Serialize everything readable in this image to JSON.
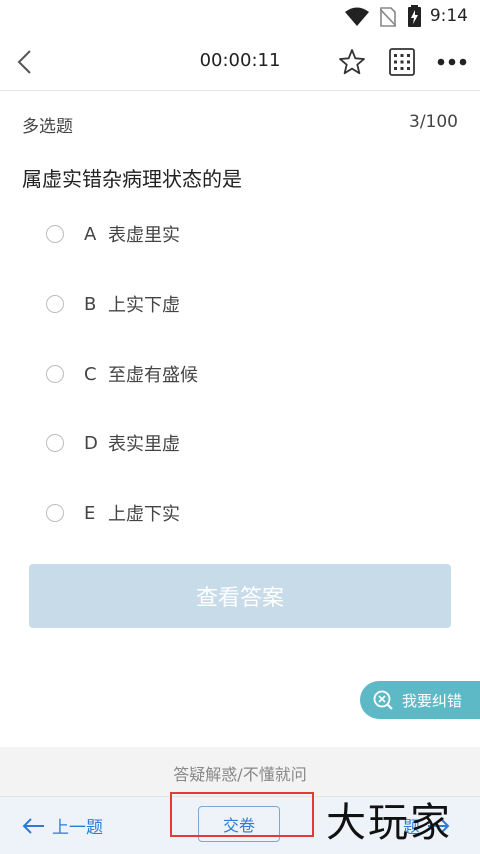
{
  "status_bar": {
    "time": "9:14"
  },
  "header": {
    "timer": "00:00:11"
  },
  "question_meta": {
    "type": "多选题",
    "progress": "3/100"
  },
  "question": {
    "text": "属虚实错杂病理状态的是"
  },
  "options": [
    {
      "letter": "A",
      "text": "表虚里实"
    },
    {
      "letter": "B",
      "text": "上实下虚"
    },
    {
      "letter": "C",
      "text": "至虚有盛候"
    },
    {
      "letter": "D",
      "text": "表实里虚"
    },
    {
      "letter": "E",
      "text": "上虚下实"
    }
  ],
  "view_answer_label": "查看答案",
  "correction_label": "我要纠错",
  "qa_label": "答疑解惑/不懂就问",
  "bottom_bar": {
    "prev_label": "上一题",
    "submit_label": "交卷",
    "next_label": "题"
  },
  "watermark": "大玩家",
  "colors": {
    "accent": "#2e7bd6",
    "teal": "#5db9c6",
    "disabled_button": "#c8dbe9"
  }
}
